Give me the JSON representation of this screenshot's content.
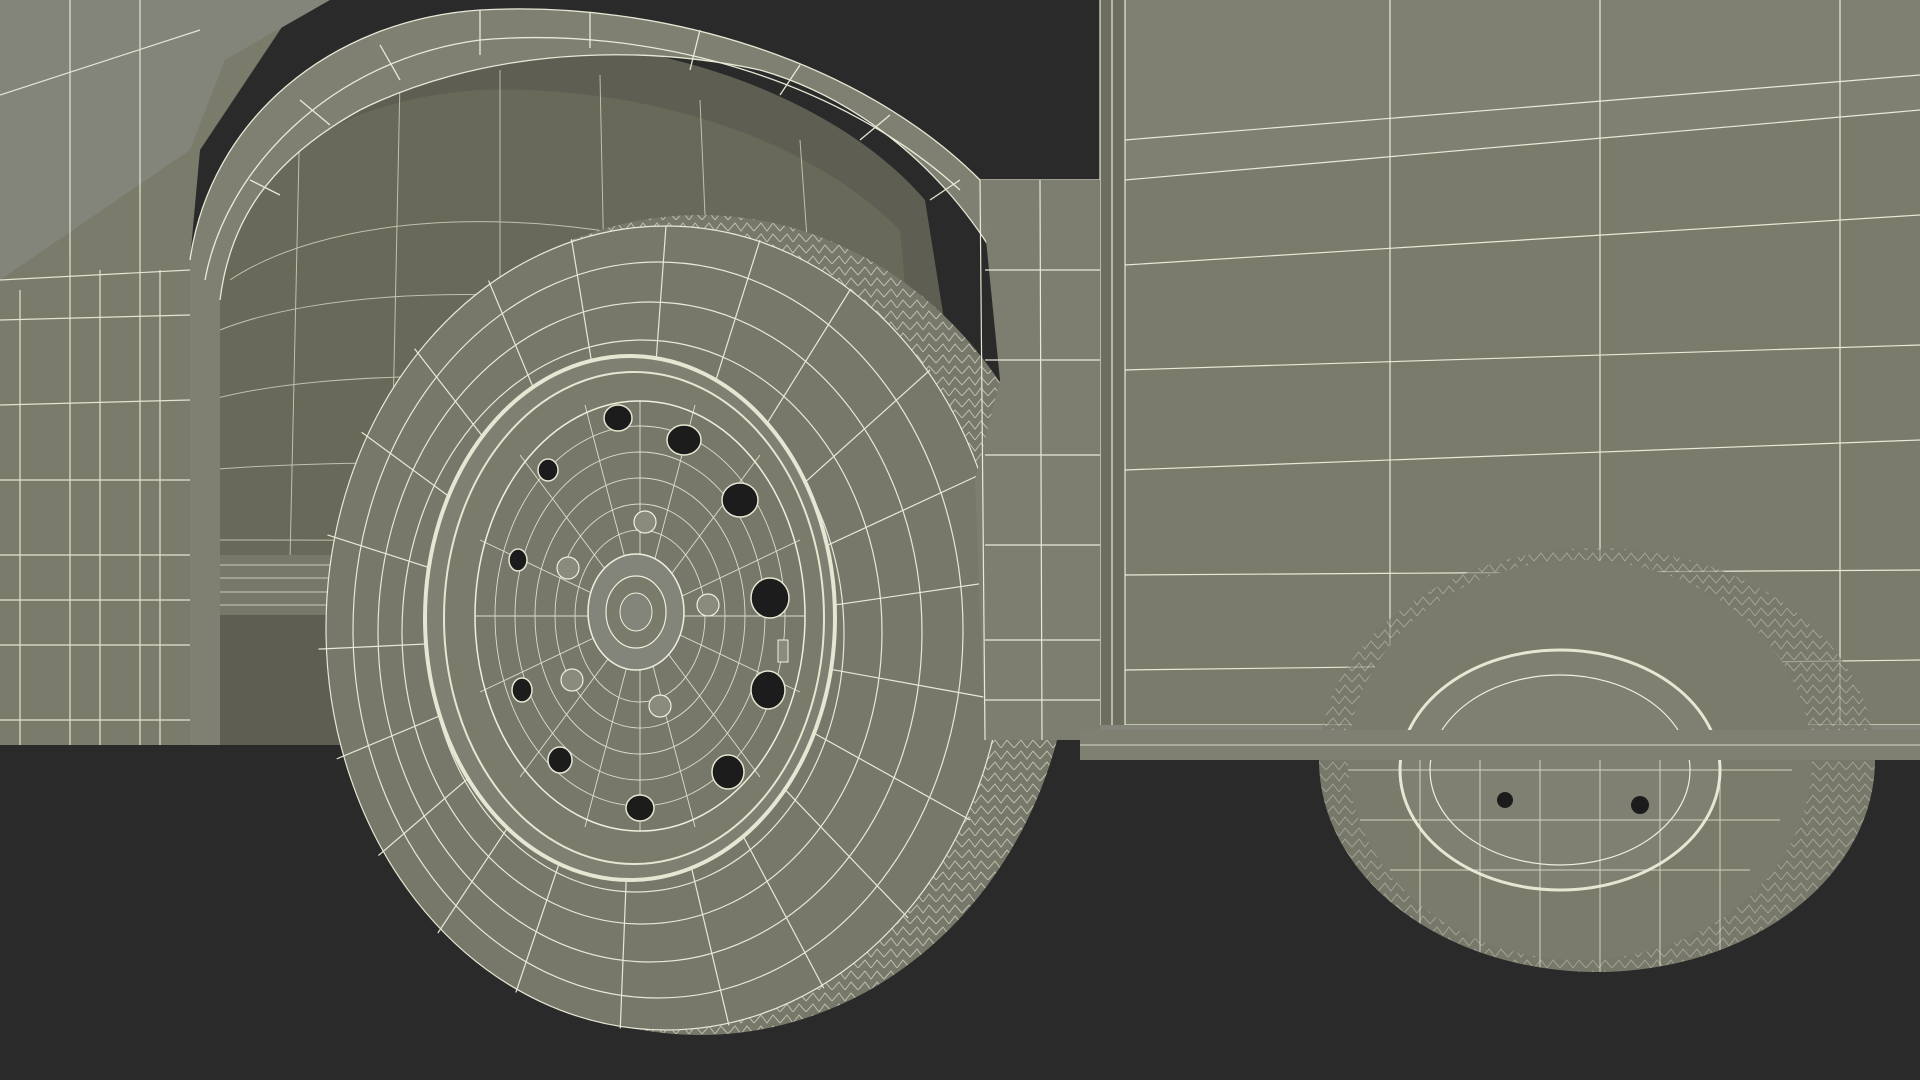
{
  "render": {
    "subject": "wireframe-vehicle-wheel",
    "palette": {
      "ground": "#2a2a2a",
      "body": "#7a7b6b",
      "body_dark": "#6a6b5c",
      "body_light": "#83847a",
      "arch_inner": "#5e5f52",
      "tire": "#77786a",
      "wire": "#eeefdc",
      "rim_ring": "#e6e7d2",
      "hole": "#1c1c1c"
    },
    "icons": [
      "wheel-icon",
      "tire-icon",
      "rim-icon",
      "lug-nut-icon"
    ]
  }
}
